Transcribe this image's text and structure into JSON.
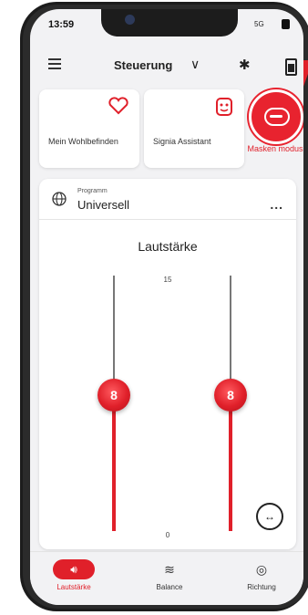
{
  "status_bar": {
    "time": "13:59",
    "signal": "5G"
  },
  "header": {
    "title": "Steuerung"
  },
  "tiles": [
    {
      "label": "Mein Wohlbefinden",
      "icon": "heart-icon"
    },
    {
      "label": "Signia Assistant",
      "icon": "assistant-face-icon"
    }
  ],
  "mask_mode": {
    "label": "Masken modus",
    "icon": "mask-icon"
  },
  "program": {
    "caption": "Programm",
    "value": "Universell",
    "more": "..."
  },
  "volume": {
    "title": "Lautstärke",
    "scale_max": "15",
    "scale_min": "0",
    "left": {
      "value": "8",
      "level_fraction": 0.533
    },
    "right": {
      "value": "8",
      "level_fraction": 0.533
    }
  },
  "nav": [
    {
      "label": "Lautstärke",
      "icon": "speaker-icon",
      "active": true
    },
    {
      "label": "Balance",
      "icon": "balance-icon",
      "active": false
    },
    {
      "label": "Richtung",
      "icon": "direction-icon",
      "active": false
    }
  ],
  "colors": {
    "accent": "#e0202a",
    "background": "#f2f2f4"
  }
}
